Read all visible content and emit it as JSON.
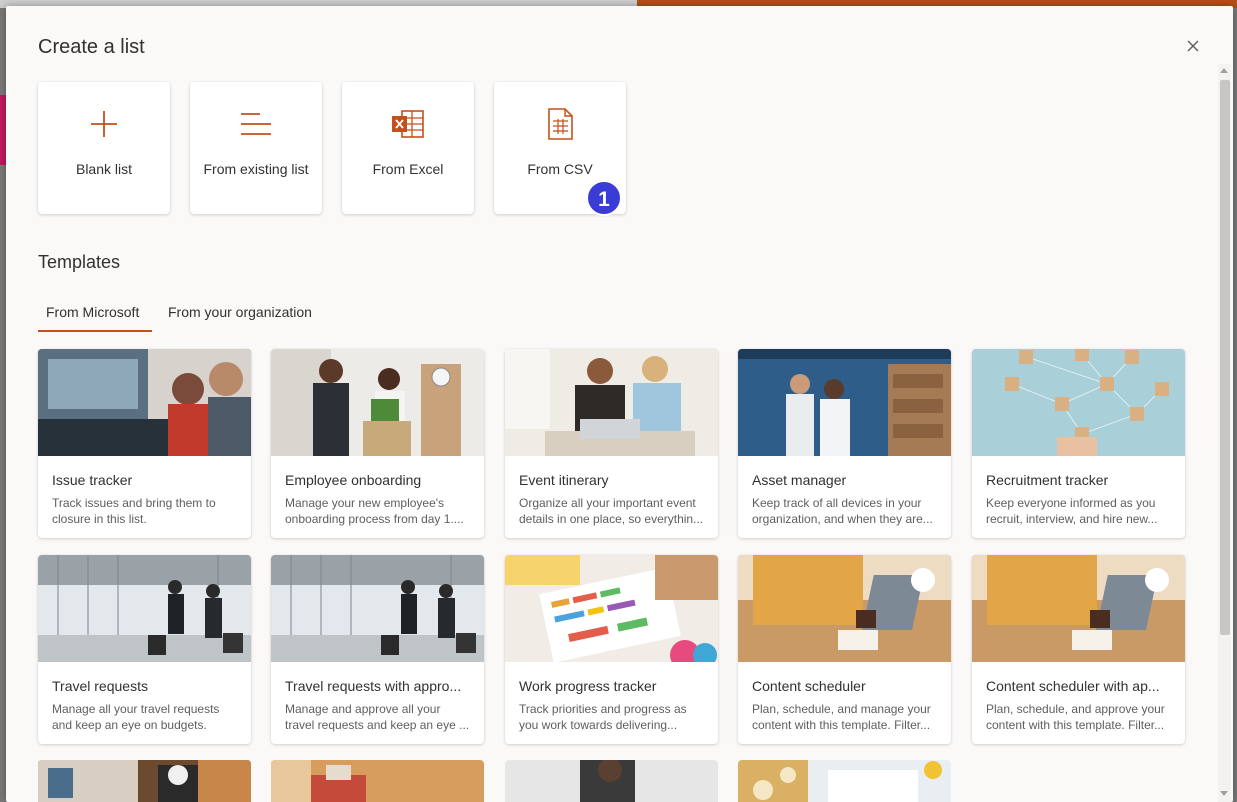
{
  "dialog": {
    "title": "Create a list",
    "close_icon": "close-icon"
  },
  "create_options": [
    {
      "label": "Blank list",
      "icon": "plus-icon"
    },
    {
      "label": "From existing list",
      "icon": "list-lines-icon"
    },
    {
      "label": "From Excel",
      "icon": "excel-icon"
    },
    {
      "label": "From CSV",
      "icon": "csv-file-icon"
    }
  ],
  "badge": {
    "value": "1",
    "color": "#3b3bd6"
  },
  "templates": {
    "heading": "Templates",
    "tabs": [
      {
        "label": "From Microsoft",
        "selected": true
      },
      {
        "label": "From your organization",
        "selected": false
      }
    ],
    "cards": [
      {
        "name": "Issue tracker",
        "desc1": "Track issues and bring them to",
        "desc2": "closure in this list."
      },
      {
        "name": "Employee onboarding",
        "desc1": "Manage your new employee's",
        "desc2": "onboarding process from day 1...."
      },
      {
        "name": "Event itinerary",
        "desc1": "Organize all your important event",
        "desc2": "details in one place, so everythin..."
      },
      {
        "name": "Asset manager",
        "desc1": "Keep track of all devices in your",
        "desc2": "organization, and when they are..."
      },
      {
        "name": "Recruitment tracker",
        "desc1": "Keep everyone informed as you",
        "desc2": "recruit, interview, and hire new..."
      },
      {
        "name": "Travel requests",
        "desc1": "Manage all your travel requests",
        "desc2": "and keep an eye on budgets."
      },
      {
        "name": "Travel requests with appro...",
        "desc1": "Manage and approve all your",
        "desc2": "travel requests and keep an eye ..."
      },
      {
        "name": "Work progress tracker",
        "desc1": "Track priorities and progress as",
        "desc2": "you work towards delivering..."
      },
      {
        "name": "Content scheduler",
        "desc1": "Plan, schedule, and manage your",
        "desc2": "content with this template. Filter..."
      },
      {
        "name": "Content scheduler with ap...",
        "desc1": "Plan, schedule, and approve your",
        "desc2": "content with this template. Filter..."
      }
    ]
  },
  "colors": {
    "accent": "#c4501b",
    "tab_underline": "#c4501b"
  }
}
